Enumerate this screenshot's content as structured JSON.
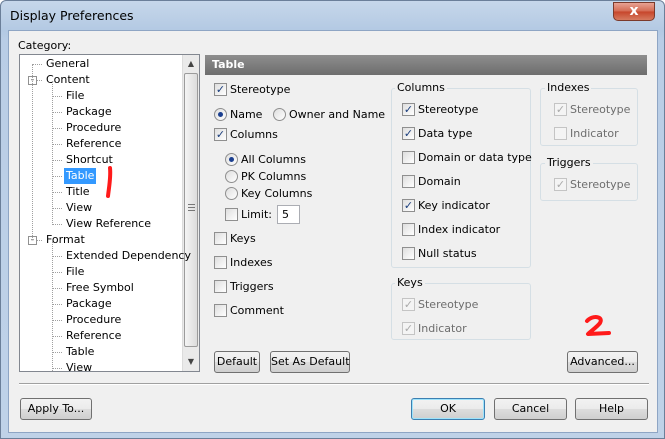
{
  "window": {
    "title": "Display Preferences",
    "close_glyph": "x"
  },
  "category": {
    "label": "Category:",
    "tree": [
      {
        "label": "General"
      },
      {
        "label": "Content",
        "expander": "-"
      },
      {
        "label": "File"
      },
      {
        "label": "Package"
      },
      {
        "label": "Procedure"
      },
      {
        "label": "Reference"
      },
      {
        "label": "Shortcut"
      },
      {
        "label": "Table",
        "selected": true
      },
      {
        "label": "Title"
      },
      {
        "label": "View"
      },
      {
        "label": "View Reference"
      },
      {
        "label": "Format",
        "expander": "-"
      },
      {
        "label": "Extended Dependency"
      },
      {
        "label": "File"
      },
      {
        "label": "Free Symbol"
      },
      {
        "label": "Package"
      },
      {
        "label": "Procedure"
      },
      {
        "label": "Reference"
      },
      {
        "label": "Table"
      },
      {
        "label": "View"
      }
    ]
  },
  "panel": {
    "title": "Table",
    "stereotype": {
      "label": "Stereotype",
      "checked": true
    },
    "name_radio": {
      "label": "Name",
      "selected": true
    },
    "owner_radio": {
      "label": "Owner and Name",
      "selected": false
    },
    "columns_cb": {
      "label": "Columns",
      "checked": true
    },
    "all_columns": {
      "label": "All Columns",
      "selected": true
    },
    "pk_columns": {
      "label": "PK Columns",
      "selected": false
    },
    "key_columns": {
      "label": "Key Columns",
      "selected": false
    },
    "limit": {
      "label": "Limit:",
      "checked": false,
      "value": "5"
    },
    "keys": {
      "label": "Keys",
      "checked": false
    },
    "indexes": {
      "label": "Indexes",
      "checked": false
    },
    "triggers": {
      "label": "Triggers",
      "checked": false
    },
    "comment": {
      "label": "Comment",
      "checked": false
    }
  },
  "columns_group": {
    "title": "Columns",
    "items": [
      {
        "label": "Stereotype",
        "checked": true
      },
      {
        "label": "Data type",
        "checked": true
      },
      {
        "label": "Domain or data type",
        "checked": false
      },
      {
        "label": "Domain",
        "checked": false
      },
      {
        "label": "Key indicator",
        "checked": true
      },
      {
        "label": "Index indicator",
        "checked": false
      },
      {
        "label": "Null status",
        "checked": false
      }
    ]
  },
  "keys_group": {
    "title": "Keys",
    "items": [
      {
        "label": "Stereotype",
        "checked": true
      },
      {
        "label": "Indicator",
        "checked": true
      }
    ]
  },
  "indexes_group": {
    "title": "Indexes",
    "items": [
      {
        "label": "Stereotype",
        "checked": true
      },
      {
        "label": "Indicator",
        "checked": false
      }
    ]
  },
  "triggers_group": {
    "title": "Triggers",
    "items": [
      {
        "label": "Stereotype",
        "checked": true
      }
    ]
  },
  "buttons": {
    "default": "Default",
    "set_as_default": "Set As Default",
    "advanced": "Advanced...",
    "apply_to": "Apply To...",
    "ok": "OK",
    "cancel": "Cancel",
    "help": "Help"
  },
  "annotations": {
    "mark1": "1",
    "mark2": "2",
    "color": "#ff1a1a"
  },
  "check_glyph": "✓"
}
